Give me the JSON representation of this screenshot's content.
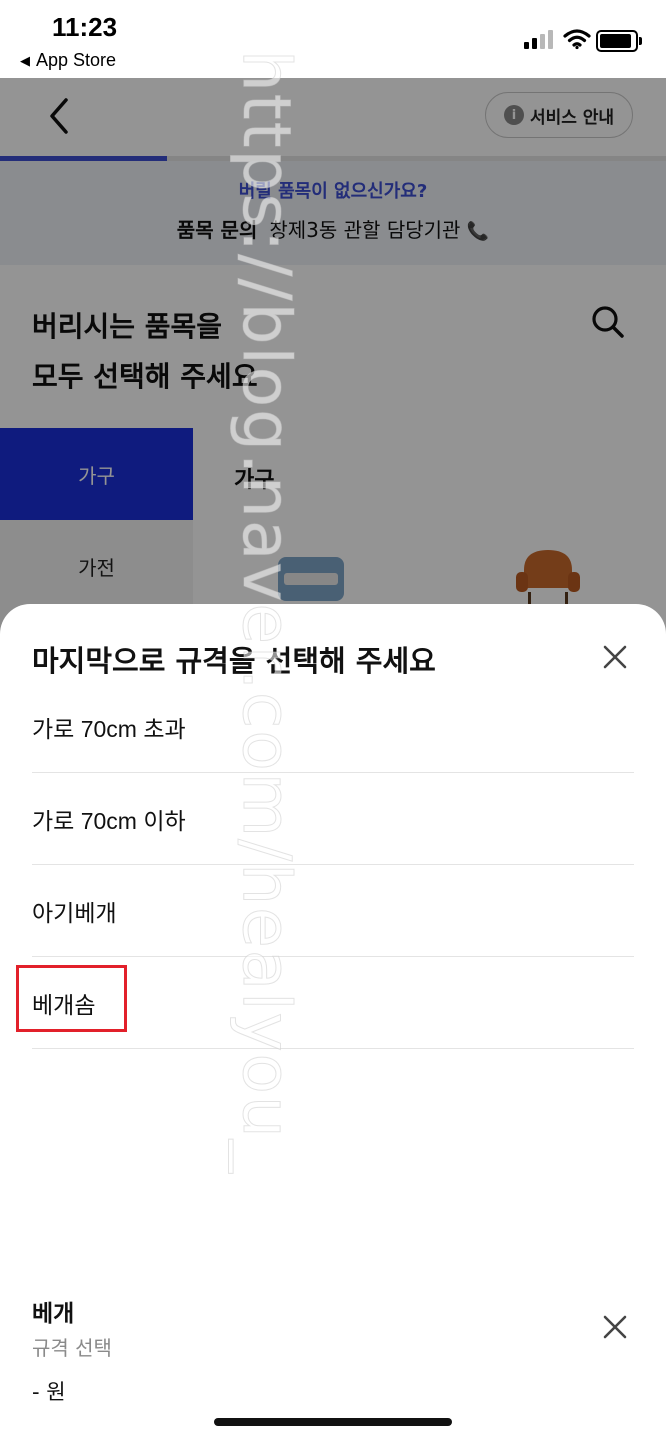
{
  "status_bar": {
    "time": "11:23",
    "back_app_label": "App Store",
    "back_glyph": "◀"
  },
  "header": {
    "service_button_label": "서비스 안내",
    "info_glyph": "i",
    "progress_fraction": 0.25
  },
  "notice": {
    "question": "버릴 품목이 없으신가요?",
    "inquiry_label": "품목 문의",
    "inquiry_text": "창제3동 관할 담당기관",
    "phone_glyph": "📞"
  },
  "page": {
    "title_line1": "버리시는 품목을",
    "title_line2": "모두 선택해 주세요"
  },
  "categories": {
    "active": "가구",
    "items": [
      "가전"
    ],
    "section_title": "가구"
  },
  "sheet": {
    "title": "마지막으로 규격을 선택해 주세요",
    "options": [
      "가로 70cm 초과",
      "가로 70cm 이하",
      "아기베개",
      "베개솜"
    ],
    "highlighted_option": "베개솜"
  },
  "selection": {
    "name": "베개",
    "spec": "규격 선택",
    "price": "- 원"
  },
  "watermark": "https://blog.naver.com/healyou_",
  "colors": {
    "accent": "#3d4ed1",
    "category_active": "#1b2fd9",
    "highlight": "#e2202a"
  },
  "icons": [
    "chevron-left-icon",
    "info-icon",
    "search-icon",
    "close-icon",
    "phone-icon",
    "wifi-icon",
    "signal-icon",
    "battery-icon"
  ]
}
